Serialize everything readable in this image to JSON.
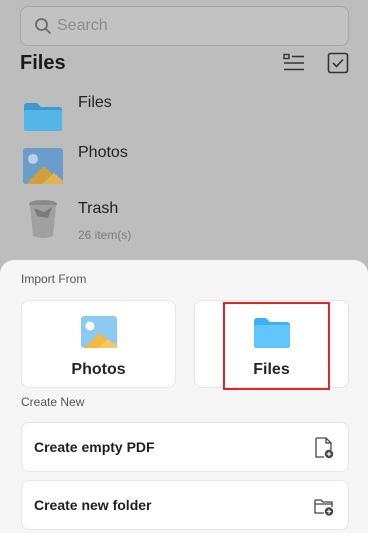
{
  "search": {
    "placeholder": "Search"
  },
  "header": {
    "title": "Files"
  },
  "file_list": [
    {
      "name": "Files",
      "icon": "folder-icon"
    },
    {
      "name": "Photos",
      "icon": "photo-icon"
    },
    {
      "name": "Trash",
      "meta": "26 item(s)",
      "icon": "trash-icon"
    }
  ],
  "sheet": {
    "import_label": "Import From",
    "import_options": [
      {
        "label": "Photos",
        "icon": "photo-icon"
      },
      {
        "label": "Files",
        "icon": "folder-icon"
      }
    ],
    "create_label": "Create New",
    "create_options": [
      {
        "label": "Create empty PDF",
        "icon": "new-pdf-icon"
      },
      {
        "label": "Create new folder",
        "icon": "new-folder-icon"
      }
    ]
  },
  "colors": {
    "folder": "#5bc1f7",
    "highlight": "#e0262a",
    "sheet_bg": "#f6f6f6",
    "dim_bg": "#bdbdbd"
  }
}
